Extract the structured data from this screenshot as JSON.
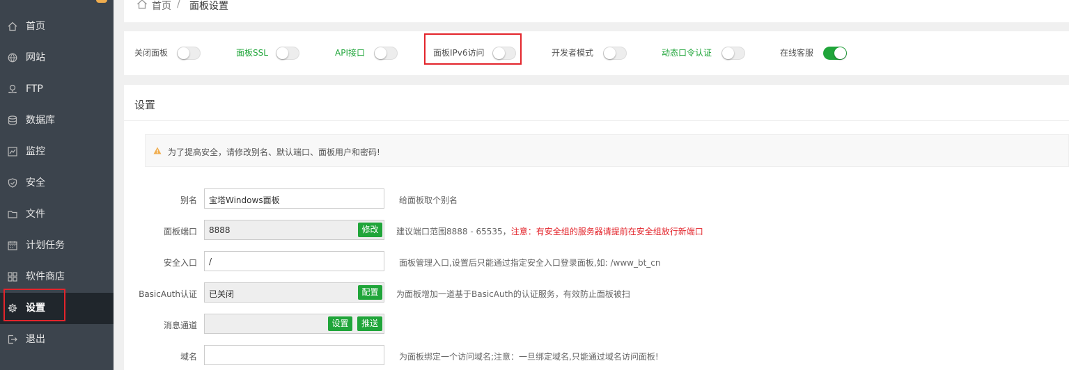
{
  "sidebar": {
    "items": [
      {
        "label": "首页",
        "icon": "home-icon"
      },
      {
        "label": "网站",
        "icon": "globe-icon"
      },
      {
        "label": "FTP",
        "icon": "ftp-icon"
      },
      {
        "label": "数据库",
        "icon": "database-icon"
      },
      {
        "label": "监控",
        "icon": "monitor-icon"
      },
      {
        "label": "安全",
        "icon": "shield-icon"
      },
      {
        "label": "文件",
        "icon": "folder-icon"
      },
      {
        "label": "计划任务",
        "icon": "calendar-icon"
      },
      {
        "label": "软件商店",
        "icon": "grid-icon"
      },
      {
        "label": "设置",
        "icon": "gear-icon",
        "active": true
      },
      {
        "label": "退出",
        "icon": "logout-icon"
      }
    ]
  },
  "breadcrumb": {
    "home": "首页",
    "separator": "/",
    "current": "面板设置"
  },
  "toggles": [
    {
      "label": "关闭面板",
      "on": false,
      "color": "gray"
    },
    {
      "label": "面板SSL",
      "on": false,
      "color": "green"
    },
    {
      "label": "API接口",
      "on": false,
      "color": "green"
    },
    {
      "label": "面板IPv6访问",
      "on": false,
      "color": "gray"
    },
    {
      "label": "开发者模式",
      "on": false,
      "color": "gray"
    },
    {
      "label": "动态口令认证",
      "on": false,
      "color": "green"
    },
    {
      "label": "在线客服",
      "on": true,
      "color": "gray"
    }
  ],
  "settings": {
    "title": "设置",
    "alert": "为了提高安全，请修改别名、默认端口、面板用户和密码!",
    "rows": {
      "alias": {
        "label": "别名",
        "value": "宝塔Windows面板",
        "hint": "给面板取个别名"
      },
      "port": {
        "label": "面板端口",
        "value": "8888",
        "button": "修改",
        "hint": "建议端口范围8888 - 65535，",
        "warn": "注意：有安全组的服务器请提前在安全组放行新端口"
      },
      "entry": {
        "label": "安全入口",
        "value": "/",
        "hint": "面板管理入口,设置后只能通过指定安全入口登录面板,如: /www_bt_cn"
      },
      "basicauth": {
        "label": "BasicAuth认证",
        "value": "已关闭",
        "button": "配置",
        "hint": "为面板增加一道基于BasicAuth的认证服务，有效防止面板被扫"
      },
      "channel": {
        "label": "消息通道",
        "value": "",
        "button1": "设置",
        "button2": "推送"
      },
      "domain": {
        "label": "域名",
        "value": "",
        "hint": "为面板绑定一个访问域名;注意：一旦绑定域名,只能通过域名访问面板!"
      }
    }
  },
  "colors": {
    "accent": "#20a53a",
    "sidebar_bg": "#3c444d",
    "highlight": "#e3242b"
  }
}
